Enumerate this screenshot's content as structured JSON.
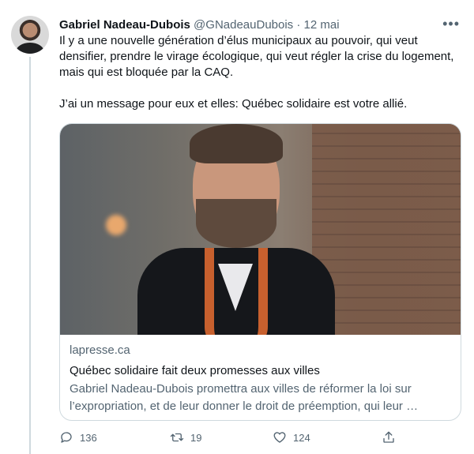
{
  "author": {
    "name": "Gabriel Nadeau-Dubois",
    "handle": "@GNadeauDubois",
    "separator": "·",
    "date": "12 mai"
  },
  "tweet": {
    "paragraph_1": "Il y a une nouvelle génération d’élus municipaux au pouvoir, qui veut densifier, prendre le virage écologique, qui veut régler la crise du logement, mais qui est bloquée par la CAQ.",
    "paragraph_2": "J’ai un message pour eux et elles: Québec solidaire est votre allié."
  },
  "card": {
    "domain": "lapresse.ca",
    "title": "Québec solidaire fait deux promesses aux villes",
    "description": "Gabriel Nadeau-Dubois promettra aux villes de réformer la loi sur l’expropriation, et de leur donner le droit de préemption, qui leur …"
  },
  "actions": {
    "reply_count": "136",
    "retweet_count": "19",
    "like_count": "124"
  },
  "icons": {
    "more": "more-options-icon",
    "reply": "reply-icon",
    "retweet": "retweet-icon",
    "like": "heart-icon",
    "share": "share-icon"
  },
  "colors": {
    "text": "#0f1419",
    "secondary": "#536471",
    "border": "#cfd9de"
  }
}
